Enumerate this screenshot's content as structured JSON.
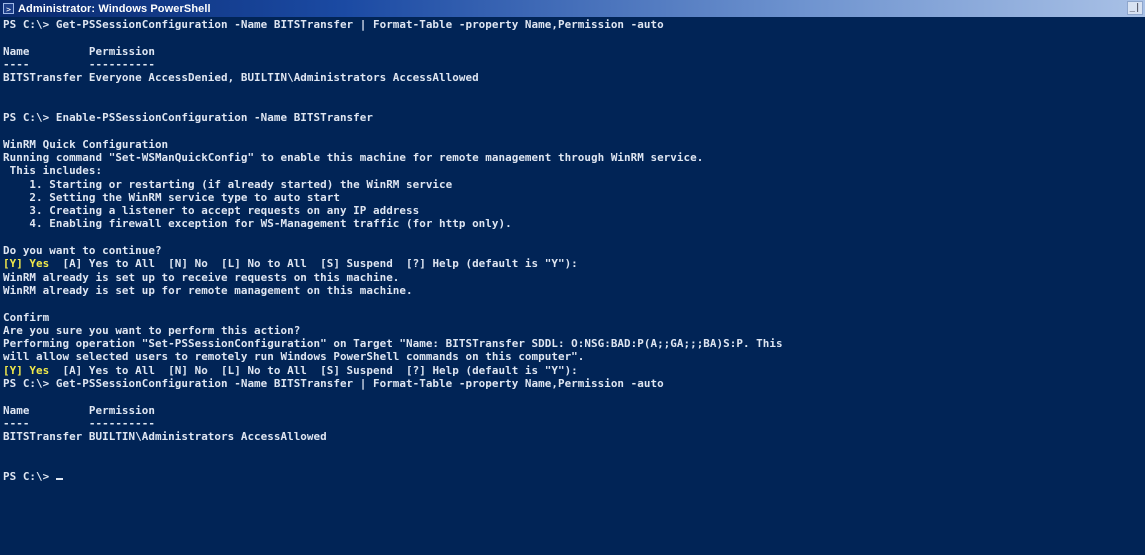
{
  "window": {
    "title": "Administrator: Windows PowerShell",
    "icon": "powershell-icon",
    "control_glyph": "_|",
    "background_color": "#012456",
    "text_color": "#dfe6f2",
    "highlight_color": "#f1e94a"
  },
  "console": {
    "lines": [
      "PS C:\\> Get-PSSessionConfiguration -Name BITSTransfer | Format-Table -property Name,Permission -auto",
      "",
      "Name         Permission",
      "----         ----------",
      "BITSTransfer Everyone AccessDenied, BUILTIN\\Administrators AccessAllowed",
      "",
      "",
      "PS C:\\> Enable-PSSessionConfiguration -Name BITSTransfer",
      "",
      "WinRM Quick Configuration",
      "Running command \"Set-WSManQuickConfig\" to enable this machine for remote management through WinRM service.",
      " This includes:",
      "    1. Starting or restarting (if already started) the WinRM service",
      "    2. Setting the WinRM service type to auto start",
      "    3. Creating a listener to accept requests on any IP address",
      "    4. Enabling firewall exception for WS-Management traffic (for http only).",
      "",
      "Do you want to continue?",
      "[Y] Yes  [A] Yes to All  [N] No  [L] No to All  [S] Suspend  [?] Help (default is \"Y\"):",
      "WinRM already is set up to receive requests on this machine.",
      "WinRM already is set up for remote management on this machine.",
      "",
      "Confirm",
      "Are you sure you want to perform this action?",
      "Performing operation \"Set-PSSessionConfiguration\" on Target \"Name: BITSTransfer SDDL: O:NSG:BAD:P(A;;GA;;;BA)S:P. This",
      "will allow selected users to remotely run Windows PowerShell commands on this computer\".",
      "[Y] Yes  [A] Yes to All  [N] No  [L] No to All  [S] Suspend  [?] Help (default is \"Y\"):",
      "PS C:\\> Get-PSSessionConfiguration -Name BITSTransfer | Format-Table -property Name,Permission -auto",
      "",
      "Name         Permission",
      "----         ----------",
      "BITSTransfer BUILTIN\\Administrators AccessAllowed",
      "",
      "",
      "PS C:\\> "
    ],
    "highlighted_prefix": "[Y] Yes"
  }
}
